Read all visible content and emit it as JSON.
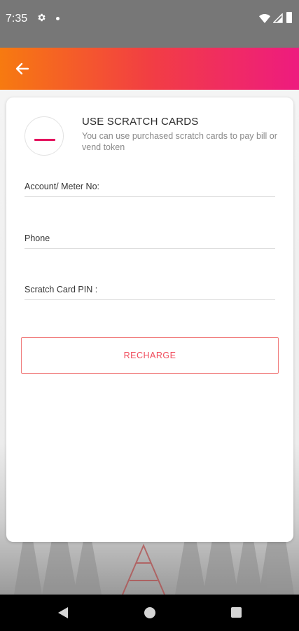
{
  "status_bar": {
    "time": "7:35",
    "icons": [
      "gear-icon",
      "notification-dot-icon",
      "wifi-icon",
      "signal-icon",
      "battery-icon"
    ]
  },
  "app_bar": {
    "back_icon": "arrow-left-icon",
    "gradient": [
      "#f77a10",
      "#f23e43",
      "#ee1b7f"
    ]
  },
  "card": {
    "icon": "minus-icon",
    "title": "USE SCRATCH CARDS",
    "subtitle": "You can use purchased scratch cards to pay bill or vend token"
  },
  "form": {
    "account_label": "Account/ Meter No:",
    "phone_label": "Phone",
    "pin_label": "Scratch Card PIN :",
    "submit_label": "RECHARGE"
  },
  "nav_bar": {
    "icons": [
      "back-triangle-icon",
      "home-circle-icon",
      "recents-square-icon"
    ]
  },
  "colors": {
    "accent": "#e4135e",
    "button_text": "#f04a5a"
  }
}
